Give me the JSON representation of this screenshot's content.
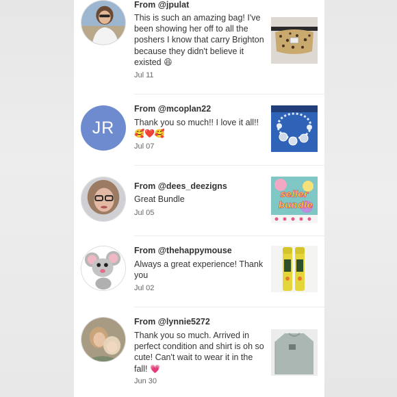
{
  "reviews": [
    {
      "from": "From @jpulat",
      "message": "This is such an amazing bag! I've been showing her off to all the poshers I know that carry Brighton because they didn't believe it existed",
      "emoji": "😆",
      "date": "Jul 11",
      "avatar_type": "photo",
      "product_icon": "leopard-belt-bag"
    },
    {
      "from": "From @mcoplan22",
      "message": "Thank you so much!! I love it all!!",
      "emoji": "🥰❤️🥰",
      "date": "Jul 07",
      "avatar_initials": "JR",
      "avatar_color": "#6f8bd0",
      "product_icon": "blue-jewelry-set"
    },
    {
      "from": "From @dees_deezigns",
      "message": "Great Bundle",
      "emoji": "",
      "date": "Jul 05",
      "avatar_type": "photo",
      "product_icon": "seller-bundle",
      "product_text_1": "seller",
      "product_text_2": "bundle"
    },
    {
      "from": "From @thehappymouse",
      "message": "Always a great experience! Thank you",
      "emoji": "",
      "date": "Jul 02",
      "avatar_type": "cartoon-mouse",
      "product_icon": "lip-balm-tubes"
    },
    {
      "from": "From @lynnie5272",
      "message": "Thank you so much. Arrived in perfect condition and shirt is oh so cute! Can't wait to wear it in the fall!",
      "emoji": "💗",
      "date": "Jun 30",
      "avatar_type": "photo",
      "product_icon": "gray-sweatshirt"
    }
  ]
}
